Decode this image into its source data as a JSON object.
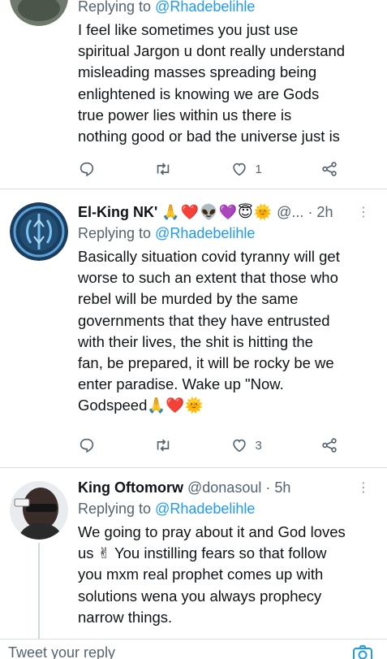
{
  "tweet1": {
    "reply_prefix": "Replying to ",
    "reply_mention": "@Rhadebelihle",
    "lines": [
      "I feel like sometimes you just use",
      "spiritual Jargon u dont really understand",
      "misleading masses spreading being",
      "enlightened is knowing  we are Gods",
      "true power lies within us  there is",
      "nothing good or bad the universe just is"
    ],
    "likes": "1",
    "retweets": ""
  },
  "tweet2": {
    "name": "El-King NK'",
    "emojis": "🙏❤️👽💜😇🌞",
    "handle": "@...",
    "time": "· 2h",
    "reply_prefix": "Replying to ",
    "reply_mention": "@Rhadebelihle",
    "lines": [
      "Basically situation covid tyranny will get",
      "worse to such an extent that those who",
      "rebel will be murded by the same",
      "governments that they have entrusted",
      "with their lives, the shit is hitting the",
      "fan, be prepared, it will be rocky be we",
      "enter paradise. Wake up \"Now.",
      "Godspeed🙏❤️🌞"
    ],
    "likes": "3"
  },
  "tweet3": {
    "name": "King Oftomorw",
    "handle": "@donasoul",
    "time": "· 5h",
    "reply_prefix": "Replying to ",
    "reply_mention": "@Rhadebelihle",
    "lines": [
      "We going to pray about it and God loves",
      "us ✌ You instilling fears so that follow",
      "you mxm real prophet comes up with",
      "solutions wena you always prophecy",
      "narrow things."
    ]
  },
  "composer": {
    "placeholder": "Tweet your reply"
  },
  "colors": {
    "accent": "#1d9bf0",
    "muted": "#536471",
    "divider": "#d8dde2"
  },
  "icons": [
    "reply-icon",
    "retweet-icon",
    "like-icon",
    "share-icon",
    "more-icon",
    "camera-icon"
  ]
}
